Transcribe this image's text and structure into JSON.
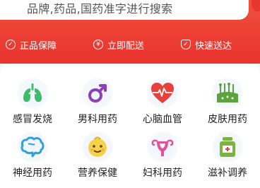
{
  "search": {
    "placeholder": "品牌,药品,国药准字进行搜索"
  },
  "guarantees": [
    {
      "label": "正品保障",
      "icon": "verified-icon"
    },
    {
      "label": "立即配送",
      "icon": "yen-icon"
    },
    {
      "label": "快速送达",
      "icon": "shield-icon"
    }
  ],
  "categories": [
    {
      "label": "感冒发烧",
      "icon": "lungs-icon",
      "color": "#3dbd6b"
    },
    {
      "label": "男科用药",
      "icon": "male-symbol-icon",
      "color": "#8e3fb5"
    },
    {
      "label": "心脑血管",
      "icon": "heart-pulse-icon",
      "color": "#e8403a"
    },
    {
      "label": "皮肤用药",
      "icon": "skin-icon",
      "color": "#5ba33c"
    },
    {
      "label": "神经用药",
      "icon": "brain-icon",
      "color": "#2fa0d8"
    },
    {
      "label": "营养保健",
      "icon": "baby-face-icon",
      "color": "#f2c23a"
    },
    {
      "label": "妇科用药",
      "icon": "uterus-icon",
      "color": "#e0529a"
    },
    {
      "label": "滋补调养",
      "icon": "medicine-bottle-icon",
      "color": "#7cb342"
    }
  ]
}
